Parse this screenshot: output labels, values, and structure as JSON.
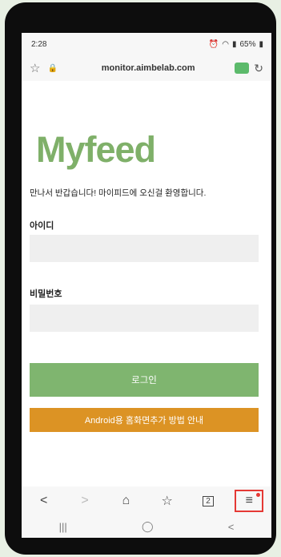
{
  "status": {
    "time": "2:28",
    "battery": "65%",
    "icons": [
      "alarm-icon",
      "wifi-icon",
      "signal-icon",
      "battery-icon"
    ]
  },
  "browser": {
    "url": "monitor.aimbelab.com"
  },
  "page": {
    "logo": "Myfeed",
    "welcome": "만나서 반갑습니다! 마이피드에 오신걸 환영합니다.",
    "id_label": "아이디",
    "id_value": "",
    "pw_label": "비밀번호",
    "pw_value": "",
    "login_label": "로그인",
    "guide_label": "Android용 홈화면추가 방법 안내"
  },
  "colors": {
    "brand": "#7fb069",
    "login_button": "#7fb56f",
    "guide_button": "#dc9324",
    "highlight": "#e53935"
  },
  "nav": {
    "tabs_count": "2"
  }
}
